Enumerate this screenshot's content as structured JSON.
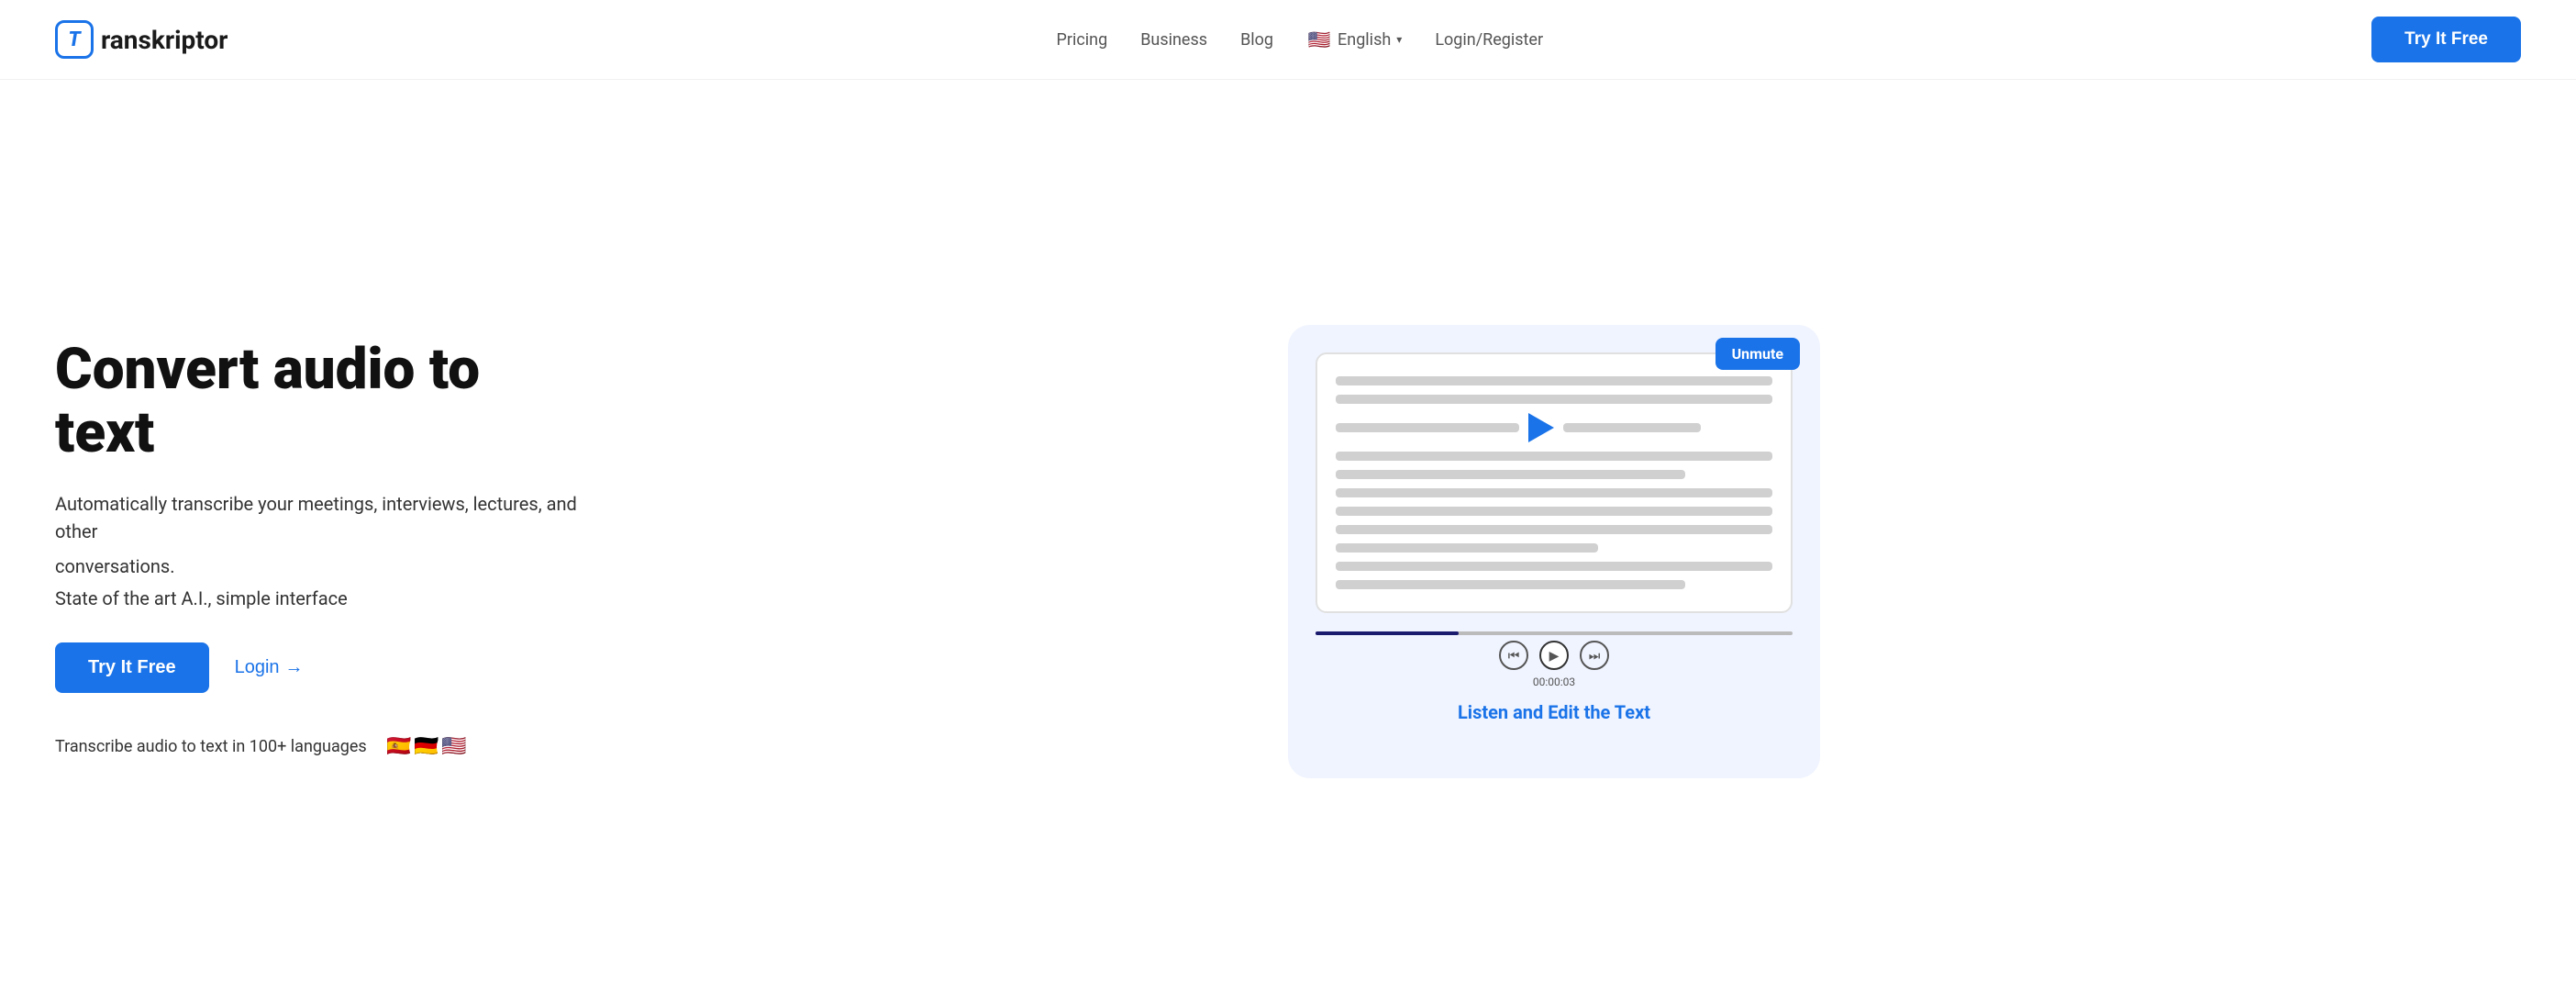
{
  "header": {
    "logo_text": "ranskriptor",
    "logo_letter": "T",
    "nav": {
      "pricing": "Pricing",
      "business": "Business",
      "blog": "Blog",
      "language": "English",
      "login_register": "Login/Register",
      "try_free": "Try It Free"
    }
  },
  "hero": {
    "title": "Convert audio to text",
    "subtitle1": "Automatically transcribe your meetings, interviews, lectures, and other",
    "subtitle2": "conversations.",
    "subtitle3": "State of the art A.I., simple interface",
    "btn_try_free": "Try It Free",
    "btn_login": "Login",
    "btn_login_arrow": "→",
    "langs_text": "Transcribe audio to text in 100+ languages",
    "flags": [
      "🇪🇸",
      "🇩🇪",
      "🇺🇸"
    ],
    "unmute_label": "Unmute",
    "listen_edit": "Listen and Edit the Text",
    "audio_time": "00:00:03"
  }
}
